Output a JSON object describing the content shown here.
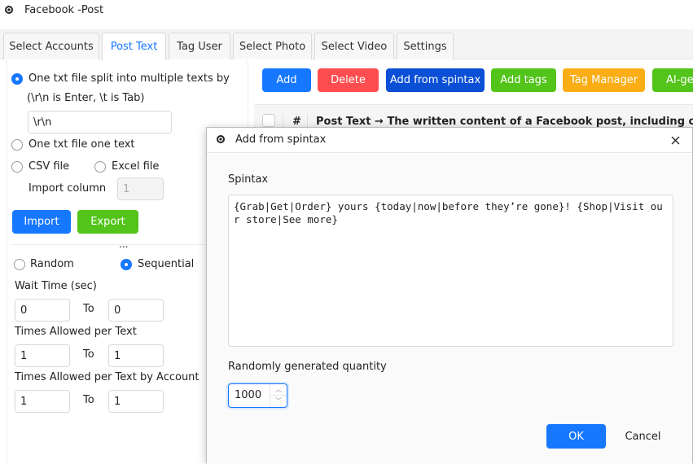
{
  "window": {
    "title": "Facebook -Post"
  },
  "tabs": [
    {
      "label": "Select Accounts"
    },
    {
      "label": "Post Text"
    },
    {
      "label": "Tag User"
    },
    {
      "label": "Select Photo"
    },
    {
      "label": "Select Video"
    },
    {
      "label": "Settings"
    }
  ],
  "left": {
    "opt_split_label": "One txt file split into multiple texts by",
    "opt_split_hint": "(\\r\\n is Enter, \\t is Tab)",
    "separator_value": "\\r\\n",
    "opt_one_text": "One txt file one text",
    "opt_csv": "CSV file",
    "opt_excel": "Excel file",
    "import_column_label": "Import column",
    "import_column_value": "1",
    "import_button": "Import",
    "export_button": "Export",
    "ellipsis": "...",
    "mode_random": "Random",
    "mode_sequential": "Sequential",
    "wait_time_label": "Wait Time (sec)",
    "wait_from": "0",
    "wait_to": "0",
    "to_label": "To",
    "times_allowed_label": "Times Allowed per Text",
    "times_from": "1",
    "times_to": "1",
    "times_by_account_label": "Times Allowed per Text by Account",
    "acct_from": "1",
    "acct_to": "1"
  },
  "toolbar": {
    "add": "Add",
    "delete": "Delete",
    "add_from_spintax": "Add from spintax",
    "add_tags": "Add tags",
    "tag_manager": "Tag Manager",
    "ai_gen": "AI-ge"
  },
  "table": {
    "col_index": "#",
    "col_post_text": "Post Text → The written content of a Facebook post, including captio"
  },
  "dialog": {
    "title": "Add from spintax",
    "spintax_label": "Spintax",
    "spintax_value": "{Grab|Get|Order} yours {today|now|before they’re gone}! {Shop|Visit our store|See more}",
    "quantity_label": "Randomly generated quantity",
    "quantity_value": "1000",
    "ok": "OK",
    "cancel": "Cancel"
  },
  "colors": {
    "accent": "#1677ff",
    "danger": "#ff4d4f",
    "success": "#52c41a",
    "warning": "#faad14",
    "primary_dark": "#0a4fd6"
  },
  "icons": [
    "app-icon",
    "close-icon",
    "chevron-up-icon",
    "chevron-down-icon"
  ]
}
